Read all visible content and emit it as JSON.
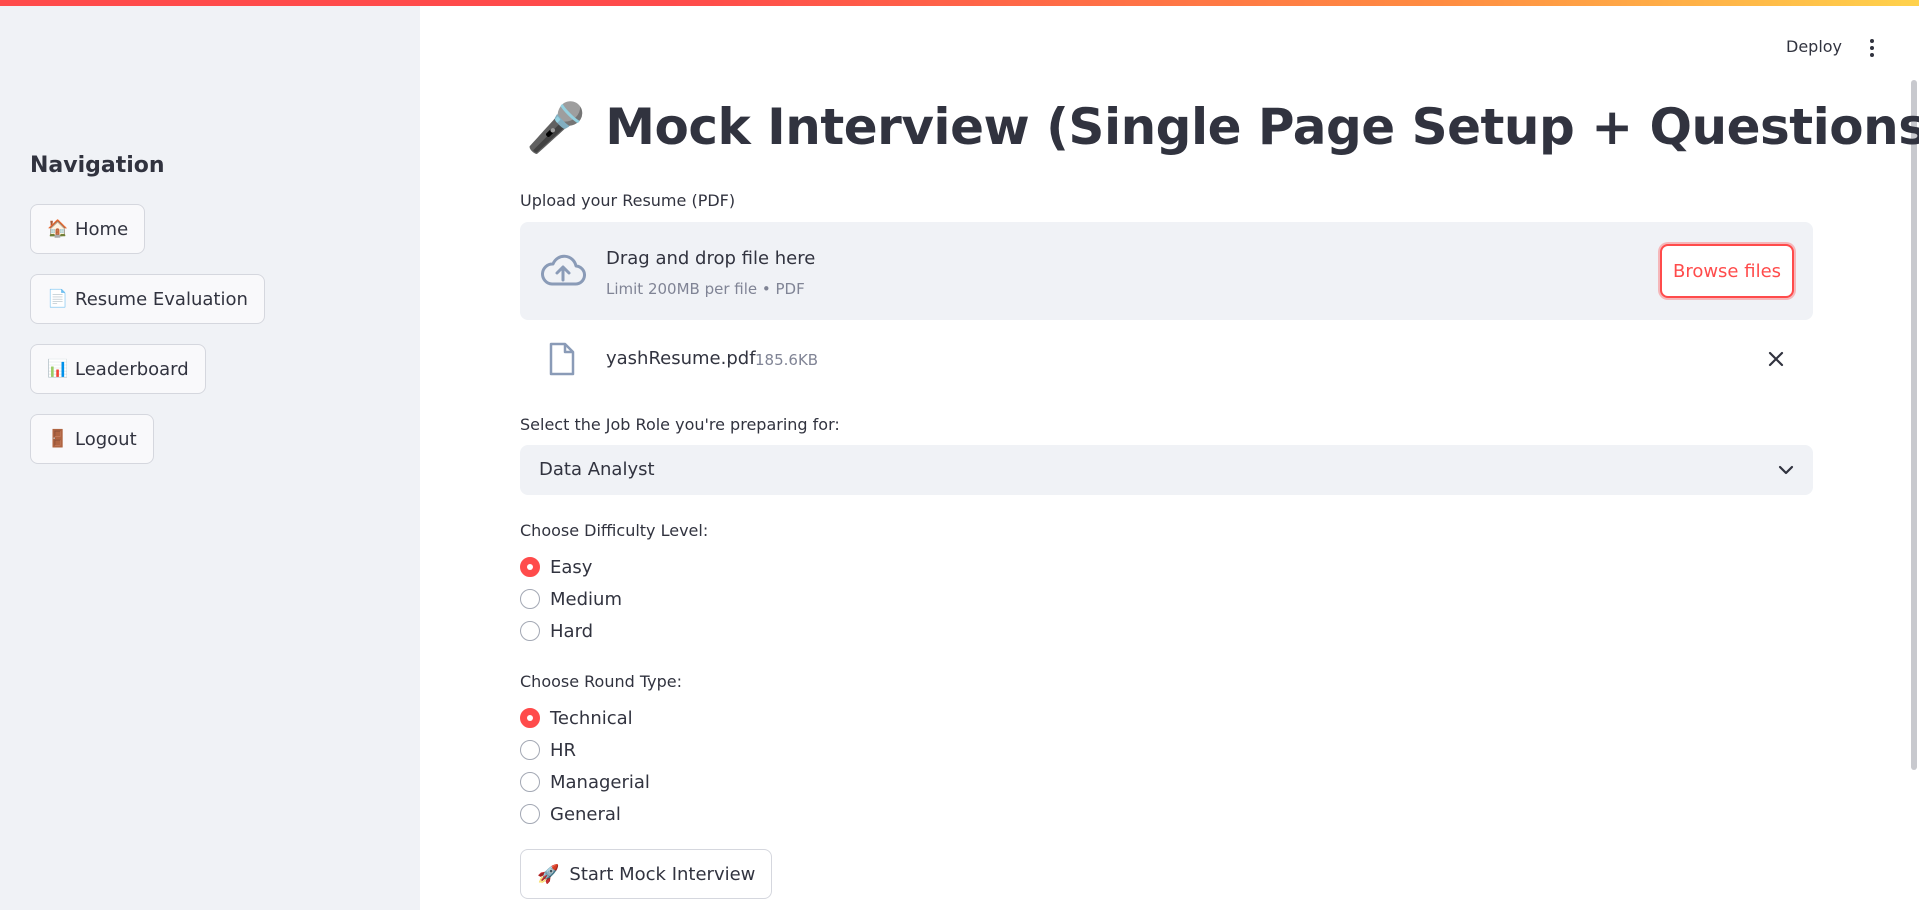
{
  "sidebar": {
    "title": "Navigation",
    "items": [
      {
        "icon": "house-icon",
        "glyph": "🏠",
        "label": "Home"
      },
      {
        "icon": "document-icon",
        "glyph": "📄",
        "label": "Resume Evaluation"
      },
      {
        "icon": "bar-chart-icon",
        "glyph": "📊",
        "label": "Leaderboard"
      },
      {
        "icon": "door-icon",
        "glyph": "🚪",
        "label": "Logout"
      }
    ]
  },
  "header": {
    "deploy_label": "Deploy"
  },
  "main": {
    "title_icon": "🎤",
    "title": "Mock Interview (Single Page Setup + Questions)",
    "upload": {
      "label": "Upload your Resume (PDF)",
      "drop_title": "Drag and drop file here",
      "drop_subtitle": "Limit 200MB per file • PDF",
      "browse_label": "Browse files",
      "file_name": "yashResume.pdf",
      "file_size": "185.6KB"
    },
    "job_role": {
      "label": "Select the Job Role you're preparing for:",
      "value": "Data Analyst"
    },
    "difficulty": {
      "label": "Choose Difficulty Level:",
      "options": [
        "Easy",
        "Medium",
        "Hard"
      ],
      "selected": "Easy"
    },
    "round_type": {
      "label": "Choose Round Type:",
      "options": [
        "Technical",
        "HR",
        "Managerial",
        "General"
      ],
      "selected": "Technical"
    },
    "start_button": {
      "glyph": "🚀",
      "label": "Start Mock Interview"
    }
  },
  "colors": {
    "accent": "#ff4b4b",
    "sidebar_bg": "#f0f2f6",
    "text": "#31333f",
    "muted": "#808495"
  }
}
